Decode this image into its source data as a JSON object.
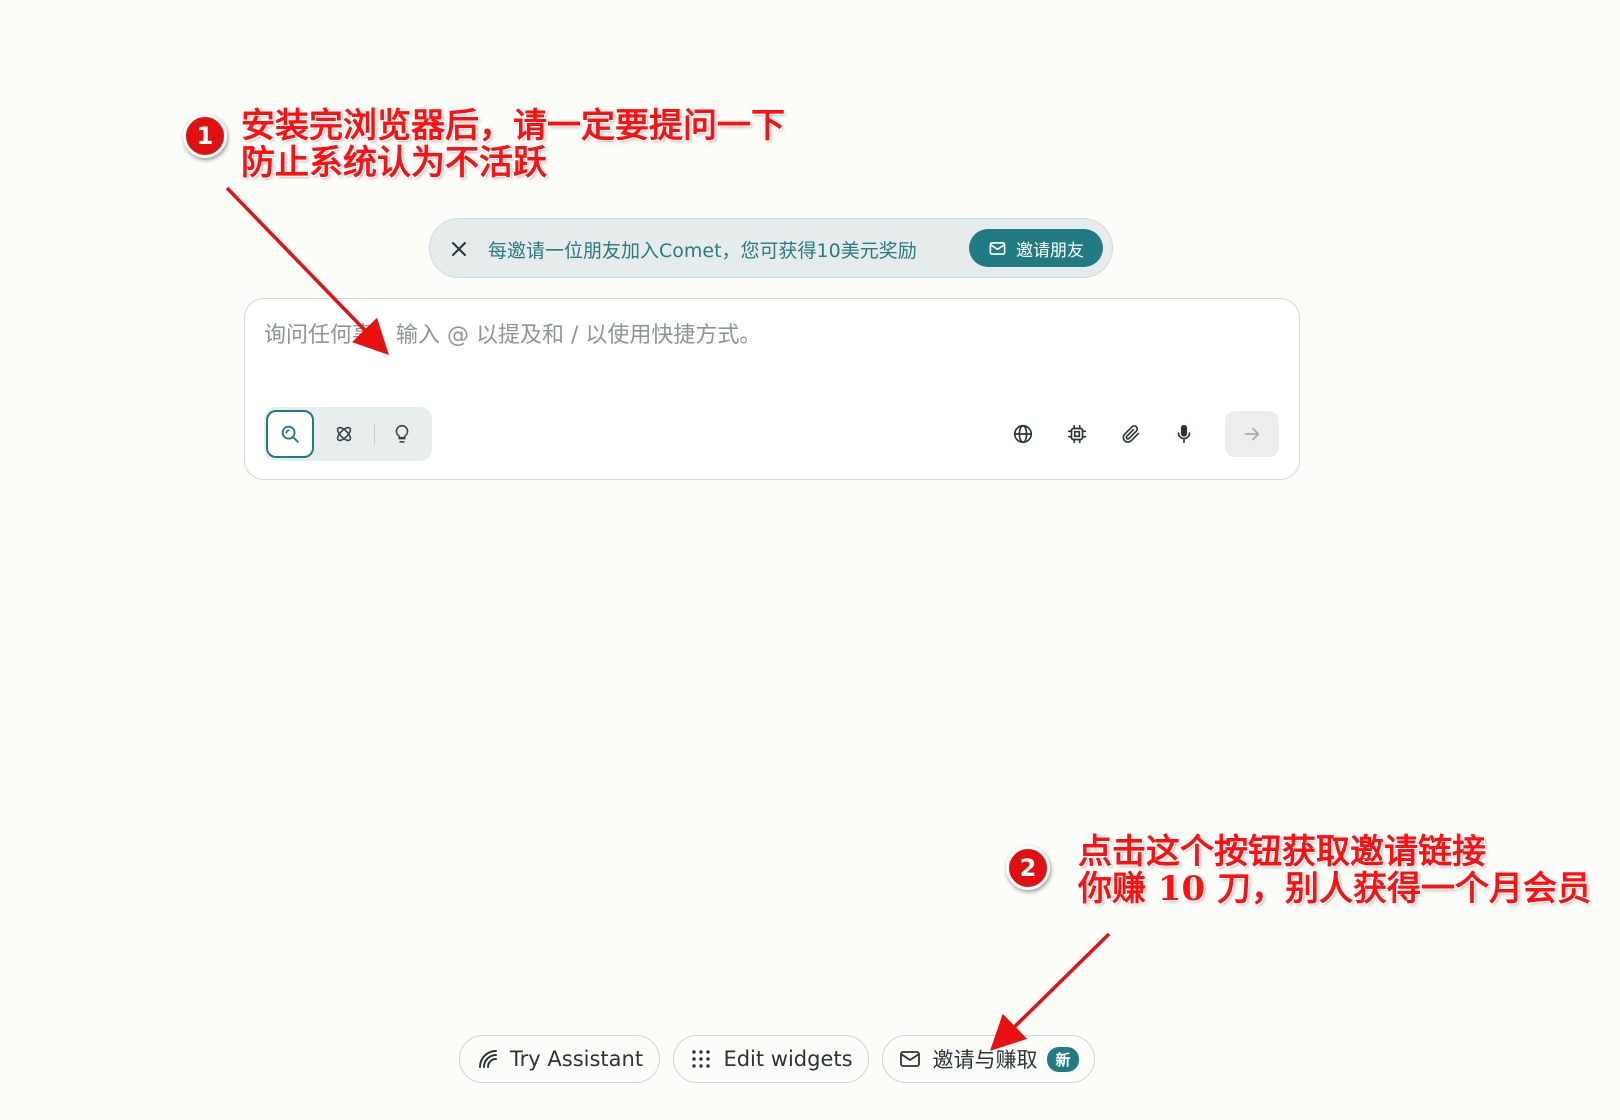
{
  "banner": {
    "text": "每邀请一位朋友加入Comet，您可获得10美元奖励",
    "button_label": "邀请朋友"
  },
  "chat": {
    "placeholder": "询问任何事。输入 @ 以提及和 / 以使用快捷方式。",
    "value": ""
  },
  "bottom_bar": {
    "assistant_label": "Try Assistant",
    "widgets_label": "Edit widgets",
    "invite_label": "邀请与赚取",
    "invite_badge": "新"
  },
  "annotations": {
    "one": {
      "number": "1",
      "line1": "安装完浏览器后，请一定要提问一下",
      "line2": "防止系统认为不活跃"
    },
    "two": {
      "number": "2",
      "line1": "点击这个按钮获取邀请链接",
      "line2": "你赚 10 刀，别人获得一个月会员"
    }
  },
  "colors": {
    "accent": "#217b83",
    "background": "#fcfcf9",
    "annotation": "#ff0f0f"
  }
}
